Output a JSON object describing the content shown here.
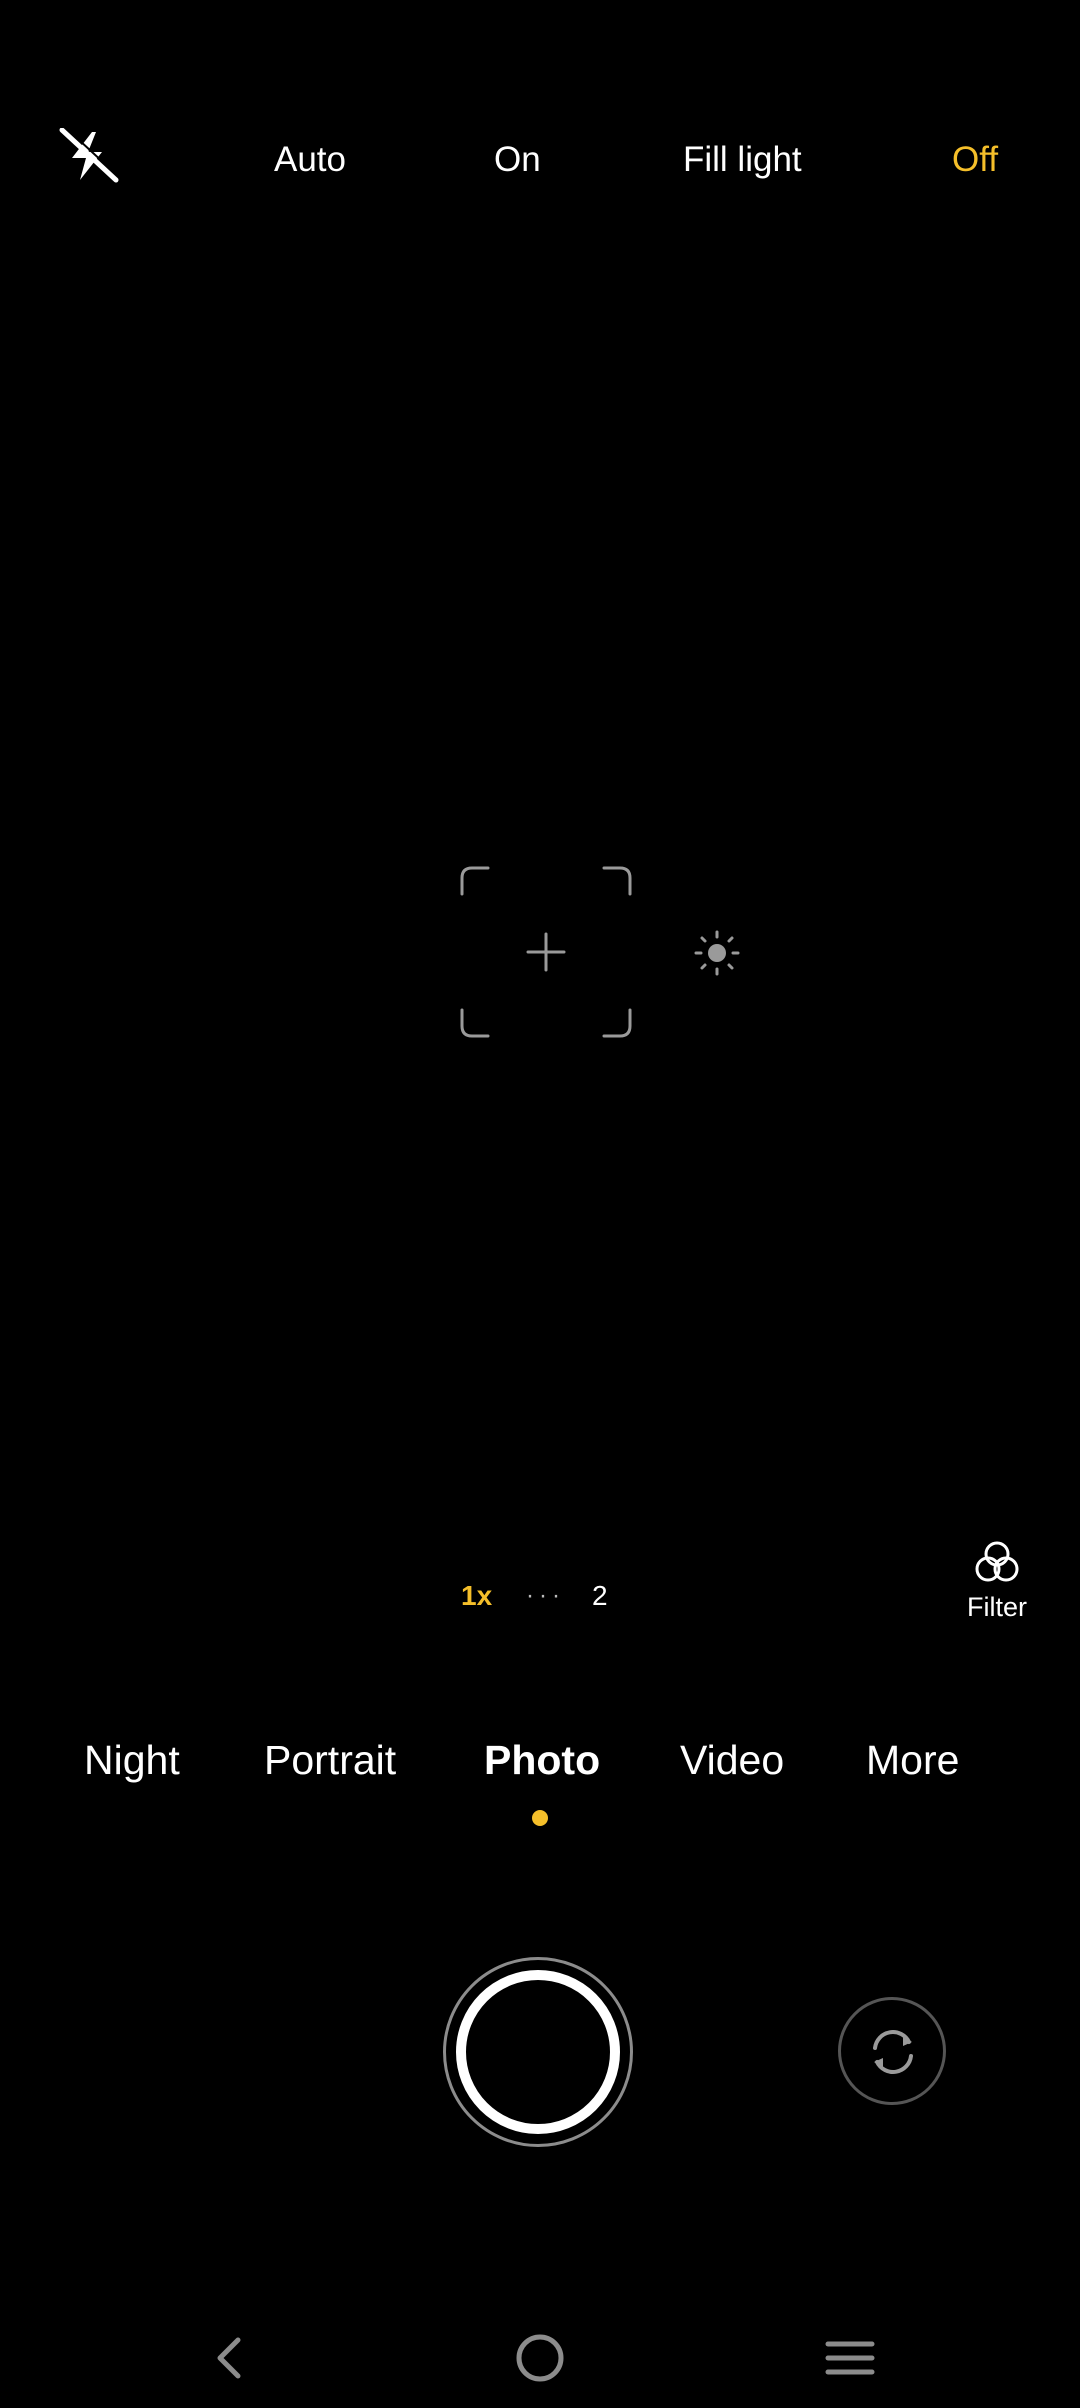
{
  "flash": {
    "icon": "flash-off-icon",
    "options": {
      "auto": "Auto",
      "on": "On",
      "fill_light": "Fill light",
      "off": "Off"
    },
    "selected": "Off"
  },
  "viewfinder": {
    "focus_icon": "focus-frame-icon",
    "exposure_icon": "sun-icon"
  },
  "zoom": {
    "current": "1x",
    "dots": "···",
    "next": "2"
  },
  "filter": {
    "label": "Filter",
    "icon": "filter-icon"
  },
  "modes": {
    "night": "Night",
    "portrait": "Portrait",
    "photo": "Photo",
    "video": "Video",
    "more": "More",
    "selected": "Photo"
  },
  "controls": {
    "shutter_icon": "shutter-icon",
    "switch_icon": "switch-camera-icon"
  },
  "navbar": {
    "back_icon": "back-icon",
    "home_icon": "home-icon",
    "menu_icon": "menu-icon"
  },
  "colors": {
    "accent": "#f5bf2a",
    "background": "#000000",
    "text": "#ffffff"
  }
}
